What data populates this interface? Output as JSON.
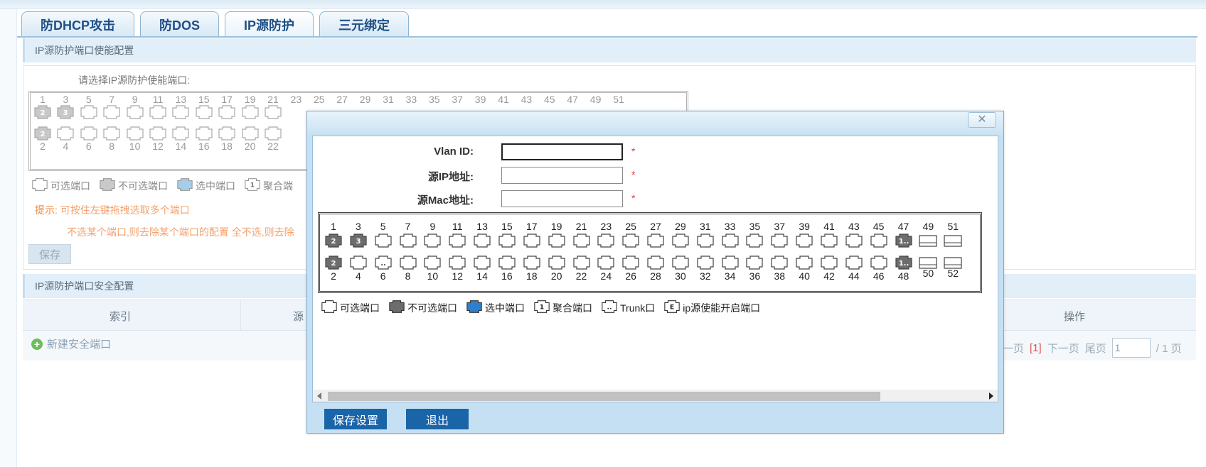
{
  "tabs": [
    {
      "label": "防DHCP攻击"
    },
    {
      "label": "防DOS"
    },
    {
      "label": "IP源防护"
    },
    {
      "label": "三元绑定"
    }
  ],
  "active_tab": "IP源防护",
  "section1": {
    "title": "IP源防护端口使能配置",
    "select_label": "请选择IP源防护使能端口:",
    "tip_label": "提示:",
    "tip_text": "可按住左键拖拽选取多个端口",
    "tip_text2": "不选某个端口,则去除某个端口的配置 全不选,则去除",
    "save_label": "保存"
  },
  "section2": {
    "title": "IP源防护端口安全配置",
    "col_index": "索引",
    "col_source": "源",
    "col_action": "操作",
    "new_port_label": "新建安全端口"
  },
  "pager": {
    "prev": "一页",
    "current": "[1]",
    "next": "下一页",
    "last": "尾页",
    "page_input": "1",
    "total": "/ 1 页"
  },
  "background_ports": {
    "top_numbers": [
      "1",
      "3",
      "5",
      "7",
      "9",
      "11",
      "13",
      "15",
      "17",
      "19",
      "21",
      "23",
      "25",
      "27",
      "29",
      "31",
      "33",
      "35",
      "37",
      "39",
      "41",
      "43",
      "45",
      "47",
      "49",
      "51"
    ],
    "bottom_numbers": [
      "2",
      "4",
      "6",
      "8",
      "10",
      "12",
      "14",
      "16",
      "18",
      "20",
      "22"
    ],
    "legend": [
      "可选端口",
      "不可选端口",
      "选中端口",
      "聚合端"
    ]
  },
  "dialog": {
    "close_symbol": "✕",
    "fields": {
      "vlan_label": "Vlan ID:",
      "ip_label": "源IP地址:",
      "mac_label": "源Mac地址:",
      "vlan_value": "",
      "ip_value": "",
      "mac_value": "",
      "required_mark": "*"
    },
    "ports": {
      "top_numbers": [
        "1",
        "3",
        "5",
        "7",
        "9",
        "11",
        "13",
        "15",
        "17",
        "19",
        "21",
        "23",
        "25",
        "27",
        "29",
        "31",
        "33",
        "35",
        "37",
        "39",
        "41",
        "43",
        "45",
        "47",
        "49",
        "51"
      ],
      "bottom_numbers": [
        "2",
        "4",
        "6",
        "8",
        "10",
        "12",
        "14",
        "16",
        "18",
        "20",
        "22",
        "24",
        "26",
        "28",
        "30",
        "32",
        "34",
        "36",
        "38",
        "40",
        "42",
        "44",
        "46",
        "48",
        "50",
        "52"
      ],
      "top_marks": [
        "2",
        "3",
        "..",
        "",
        "",
        "",
        "",
        "",
        "",
        "",
        "",
        "",
        "",
        "",
        "",
        "",
        "",
        "",
        "",
        "",
        "",
        "",
        "",
        "1..",
        "",
        ""
      ],
      "bottom_marks": [
        "2",
        "",
        "..",
        "",
        "",
        "",
        "",
        "",
        "",
        "",
        "",
        "",
        "",
        "",
        "",
        "",
        "",
        "",
        "",
        "",
        "",
        "",
        "",
        "1..",
        "",
        ""
      ]
    },
    "legend": [
      "可选端口",
      "不可选端口",
      "选中端口",
      "聚合端口",
      "Trunk口",
      "ip源使能开启端口"
    ],
    "legend_marks": [
      "",
      "",
      "",
      "1",
      "..",
      "E"
    ],
    "save_label": "保存设置",
    "exit_label": "退出"
  },
  "colors": {
    "accent": "#1a64a8",
    "tab_text": "#1f4f86",
    "tip": "#f08a3c",
    "required": "#e04040"
  }
}
